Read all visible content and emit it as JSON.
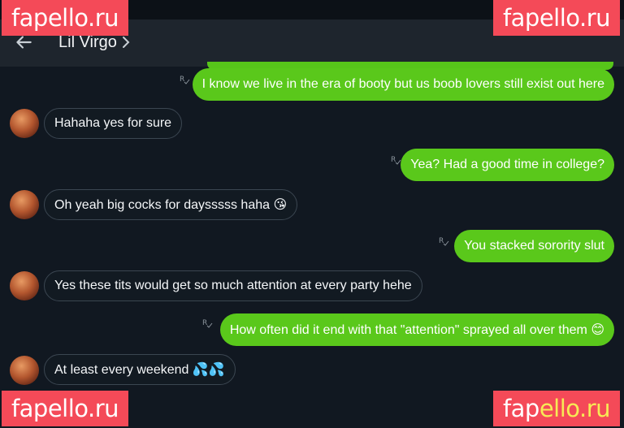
{
  "header": {
    "contact_name": "Lil Virgo"
  },
  "messages": [
    {
      "dir": "out",
      "text": "I know we live in the era of booty but us boob lovers still exist out here"
    },
    {
      "dir": "in",
      "text": "Hahaha yes for sure"
    },
    {
      "dir": "out",
      "text": "Yea? Had a good time in college?"
    },
    {
      "dir": "in",
      "text": "Oh yeah big cocks for daysssss haha",
      "emoji": "😘"
    },
    {
      "dir": "out",
      "text": "You stacked sorority slut"
    },
    {
      "dir": "in",
      "text": "Yes these tits would get so much attention at every party hehe"
    },
    {
      "dir": "out",
      "text": "How often did it end with that \"attention\" sprayed all over them",
      "emoji": "😊"
    },
    {
      "dir": "in",
      "text": "At least every weekend",
      "emoji": "💦💦"
    }
  ],
  "watermarks": {
    "top_left": {
      "text": "fapello.ru"
    },
    "top_right": {
      "text": "fapello.ru"
    },
    "bottom_left": {
      "text": "fapello.ru"
    },
    "bottom_right": {
      "part1": "fap",
      "part2": "ello.ru"
    }
  },
  "colors": {
    "background": "#111821",
    "header": "#1e252d",
    "outgoing_bubble": "#5ac81b",
    "incoming_border": "#3b4651",
    "watermark": "#f44a58"
  }
}
